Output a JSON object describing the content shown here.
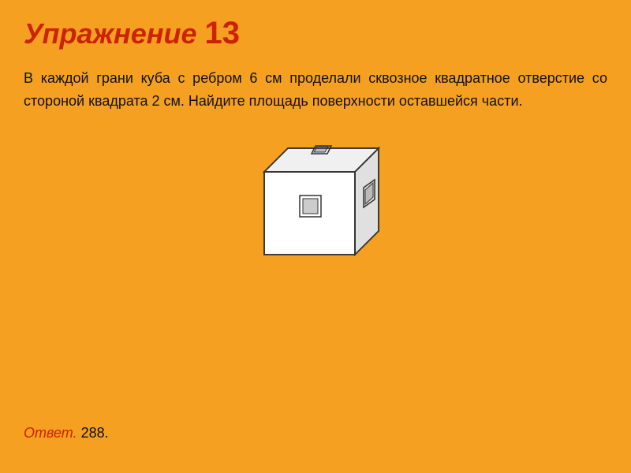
{
  "title": {
    "prefix": "Упражнение",
    "number": "13"
  },
  "problem": {
    "text": "В каждой грани куба с ребром 6 см проделали сквозное квадратное отверстие со стороной квадрата 2 см. Найдите площадь поверхности оставшейся части."
  },
  "answer": {
    "label": "Ответ.",
    "value": " 288."
  }
}
